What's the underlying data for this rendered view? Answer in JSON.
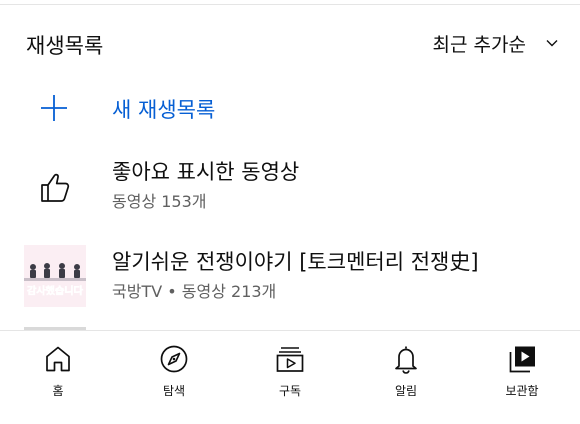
{
  "header": {
    "title": "재생목록",
    "sort_label": "최근 추가순"
  },
  "new_playlist": {
    "label": "새 재생목록"
  },
  "playlists": [
    {
      "title": "좋아요 표시한 동영상",
      "meta": "동영상 153개"
    },
    {
      "title": "알기쉬운 전쟁이야기 [토크멘터리 전쟁史]",
      "meta": "국방TV • 동영상 213개",
      "thumb_text": "감사했습니다"
    }
  ],
  "bottom_nav": [
    {
      "label": "홈",
      "icon": "home-icon"
    },
    {
      "label": "탐색",
      "icon": "explore-compass-icon"
    },
    {
      "label": "구독",
      "icon": "subscriptions-icon"
    },
    {
      "label": "알림",
      "icon": "bell-icon"
    },
    {
      "label": "보관함",
      "icon": "library-icon"
    }
  ],
  "colors": {
    "accent": "#065fd4",
    "text": "#0f0f0f",
    "secondary": "#606060",
    "divider": "#e5e5e5"
  }
}
